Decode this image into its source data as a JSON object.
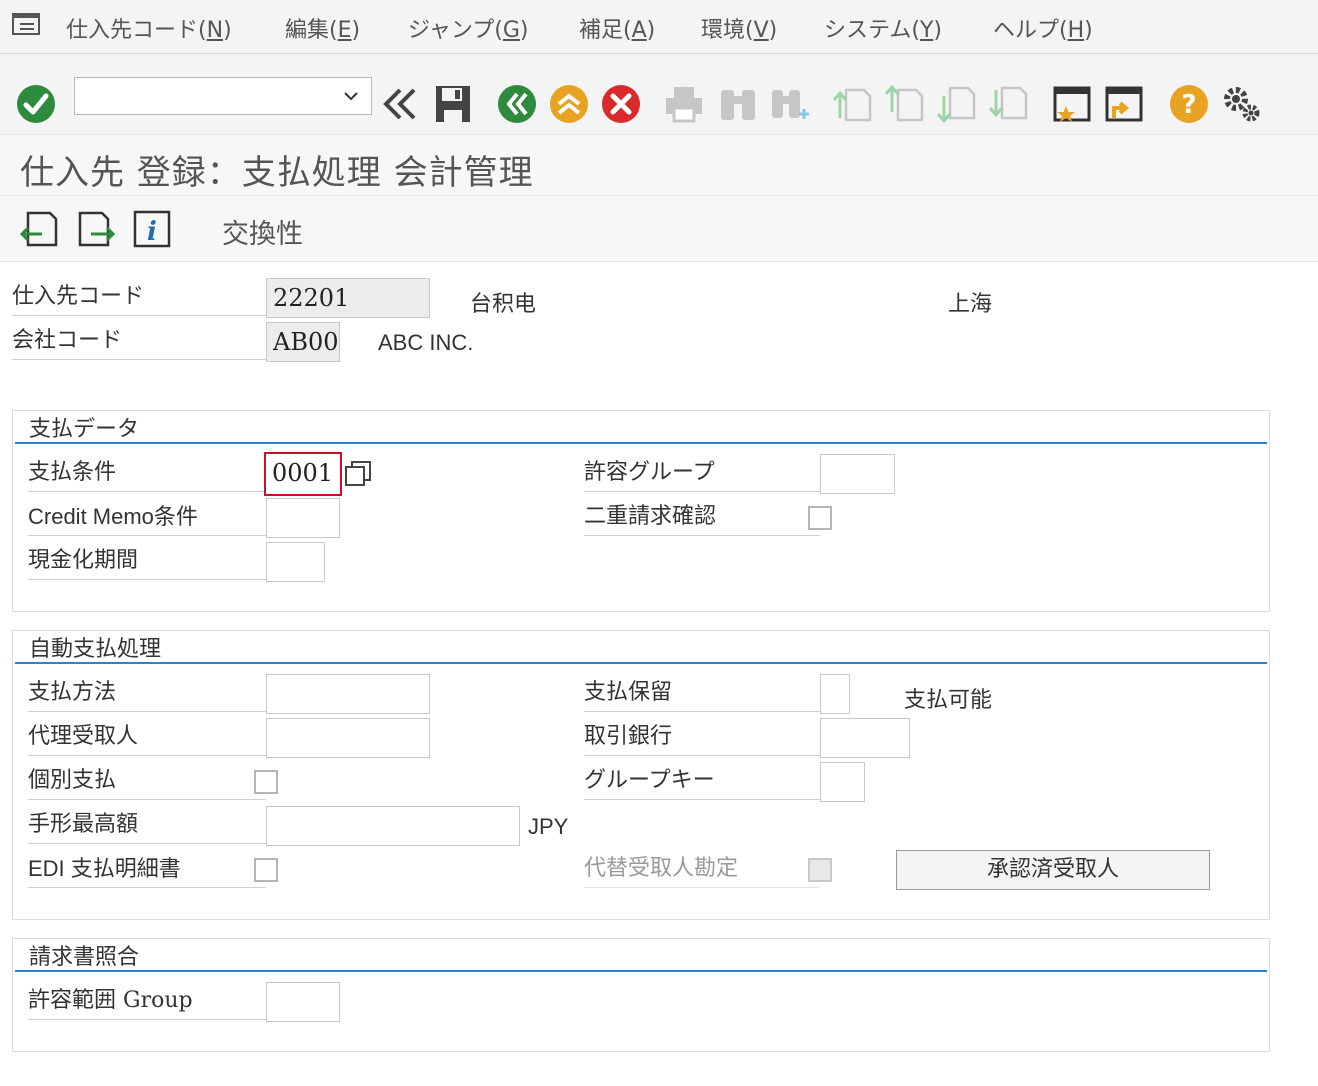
{
  "menu": {
    "items": [
      {
        "label": "仕入先コード(",
        "key": "N",
        "end": ")"
      },
      {
        "label": "編集(",
        "key": "E",
        "end": ")"
      },
      {
        "label": "ジャンプ(",
        "key": "G",
        "end": ")"
      },
      {
        "label": "補足(",
        "key": "A",
        "end": ")"
      },
      {
        "label": "環境(",
        "key": "V",
        "end": ")"
      },
      {
        "label": "システム(",
        "key": "Y",
        "end": ")"
      },
      {
        "label": "ヘルプ(",
        "key": "H",
        "end": ")"
      }
    ]
  },
  "toolbar": {
    "command_value": "",
    "icons": [
      "enter-icon",
      "back-double-icon",
      "save-icon",
      "back-icon",
      "exit-icon",
      "cancel-icon",
      "print-icon",
      "find-icon",
      "find-next-icon",
      "first-page-icon",
      "previous-page-icon",
      "next-page-icon",
      "last-page-icon",
      "create-session-icon",
      "create-shortcut-icon",
      "help-icon",
      "settings-icon"
    ]
  },
  "title": "仕入先 登録：支払処理 会計管理",
  "app_toolbar": {
    "exchange_label": "交換性"
  },
  "header": {
    "vendor_label": "仕入先コード",
    "vendor_value": "22201",
    "vendor_name": "台积电",
    "vendor_city": "上海",
    "company_label": "会社コード",
    "company_value": "AB00",
    "company_name": "ABC INC."
  },
  "payment_data": {
    "title": "支払データ",
    "terms_label": "支払条件",
    "terms_value": "0001",
    "credit_memo_label": "Credit Memo条件",
    "credit_memo_value": "",
    "cash_period_label": "現金化期間",
    "cash_period_value": "",
    "tolerance_group_label": "許容グループ",
    "tolerance_group_value": "",
    "double_invoice_label": "二重請求確認",
    "double_invoice_checked": false
  },
  "auto_payment": {
    "title": "自動支払処理",
    "method_label": "支払方法",
    "method_value": "",
    "alt_payee_label": "代理受取人",
    "alt_payee_value": "",
    "individual_label": "個別支払",
    "individual_checked": false,
    "bill_max_label": "手形最高額",
    "bill_max_value": "",
    "currency": "JPY",
    "edi_label": "EDI 支払明細書",
    "edi_checked": false,
    "block_label": "支払保留",
    "block_value": "",
    "block_text": "支払可能",
    "house_bank_label": "取引銀行",
    "house_bank_value": "",
    "grouping_key_label": "グループキー",
    "grouping_key_value": "",
    "alt_payee_doc_label": "代替受取人勘定",
    "alt_payee_doc_checked": false,
    "permitted_payee_button": "承認済受取人"
  },
  "invoice_verification": {
    "title": "請求書照合",
    "tolerance_label": "許容範囲 Group",
    "tolerance_value": ""
  }
}
